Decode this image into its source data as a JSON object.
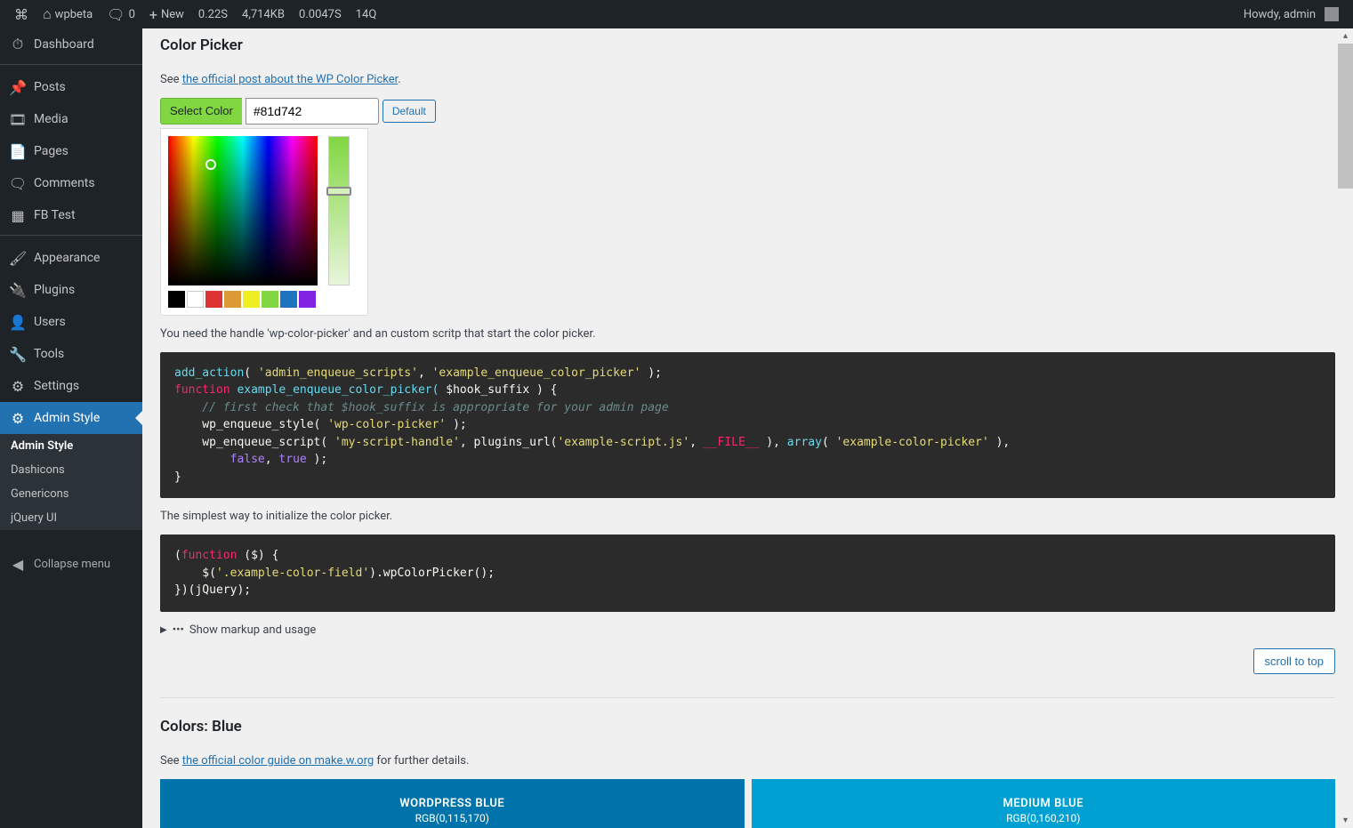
{
  "adminbar": {
    "site_name": "wpbeta",
    "comments_count": "0",
    "new_label": "New",
    "stats": {
      "time1": "0.22S",
      "mem": "4,714KB",
      "time2": "0.0047S",
      "queries": "14Q"
    },
    "howdy": "Howdy, admin"
  },
  "menu": {
    "items": [
      {
        "label": "Dashboard",
        "icon": "dashboard"
      },
      {
        "label": "Posts",
        "icon": "pin"
      },
      {
        "label": "Media",
        "icon": "media"
      },
      {
        "label": "Pages",
        "icon": "pages"
      },
      {
        "label": "Comments",
        "icon": "comment"
      },
      {
        "label": "FB Test",
        "icon": "generic"
      },
      {
        "label": "Appearance",
        "icon": "brush"
      },
      {
        "label": "Plugins",
        "icon": "plug"
      },
      {
        "label": "Users",
        "icon": "user"
      },
      {
        "label": "Tools",
        "icon": "wrench"
      },
      {
        "label": "Settings",
        "icon": "gear"
      },
      {
        "label": "Admin Style",
        "icon": "gear",
        "current": true
      }
    ],
    "submenu": [
      {
        "label": "Admin Style",
        "current": true
      },
      {
        "label": "Dashicons"
      },
      {
        "label": "Genericons"
      },
      {
        "label": "jQuery UI"
      }
    ],
    "collapse_label": "Collapse menu"
  },
  "page": {
    "color_picker": {
      "title": "Color Picker",
      "desc_prefix": "See ",
      "desc_link": "the official post about the WP Color Picker",
      "desc_suffix": ".",
      "select_btn": "Select Color",
      "color_value": "#81d742",
      "default_btn": "Default",
      "palette": [
        "#000000",
        "#ffffff",
        "#dd3333",
        "#dd9933",
        "#eeee22",
        "#81d742",
        "#1e73be",
        "#8224e3"
      ],
      "para_handle": "You need the handle 'wp-color-picker' and an custom scritp that start the color picker.",
      "para_init": "The simplest way to initialize the color picker.",
      "details_label": "Show markup and usage",
      "scroll_top_label": "scroll to top"
    },
    "colors_blue": {
      "title": "Colors: Blue",
      "desc_prefix": "See ",
      "desc_link": "the official color guide on make.w.org",
      "desc_suffix": " for further details.",
      "swatches": [
        {
          "name": "WORDPRESS BLUE",
          "rgb": "RGB(0,115,170)",
          "hex": "#0073aa"
        },
        {
          "name": "MEDIUM BLUE",
          "rgb": "RGB(0,160,210)",
          "hex": "#00a0d2"
        }
      ]
    },
    "code1": {
      "l1a": "add_action",
      "l1b": "( ",
      "l1c": "'admin_enqueue_scripts'",
      "l1d": ", ",
      "l1e": "'example_enqueue_color_picker'",
      "l1f": " );",
      "l2a": "function",
      "l2b": " example_enqueue_color_picker( ",
      "l2c": "$hook_suffix",
      "l2d": " ) {",
      "l3": "    // first check that $hook_suffix is appropriate for your admin page",
      "l4a": "    wp_enqueue_style( ",
      "l4b": "'wp-color-picker'",
      "l4c": " );",
      "l5a": "    wp_enqueue_script( ",
      "l5b": "'my-script-handle'",
      "l5c": ", plugins_url(",
      "l5d": "'example-script.js'",
      "l5e": ", ",
      "l5f": "__FILE__",
      "l5g": " ), ",
      "l5h": "array",
      "l5i": "( ",
      "l5j": "'example-color-picker'",
      "l5k": " ),",
      "l6a": "        ",
      "l6b": "false",
      "l6c": ", ",
      "l6d": "true",
      "l6e": " );",
      "l7": "}"
    },
    "code2": {
      "l1a": "(",
      "l1b": "function",
      "l1c": " ($) {",
      "l2a": "    $(",
      "l2b": "'.example-color-field'",
      "l2c": ").wpColorPicker();",
      "l3": "})(jQuery);"
    }
  }
}
